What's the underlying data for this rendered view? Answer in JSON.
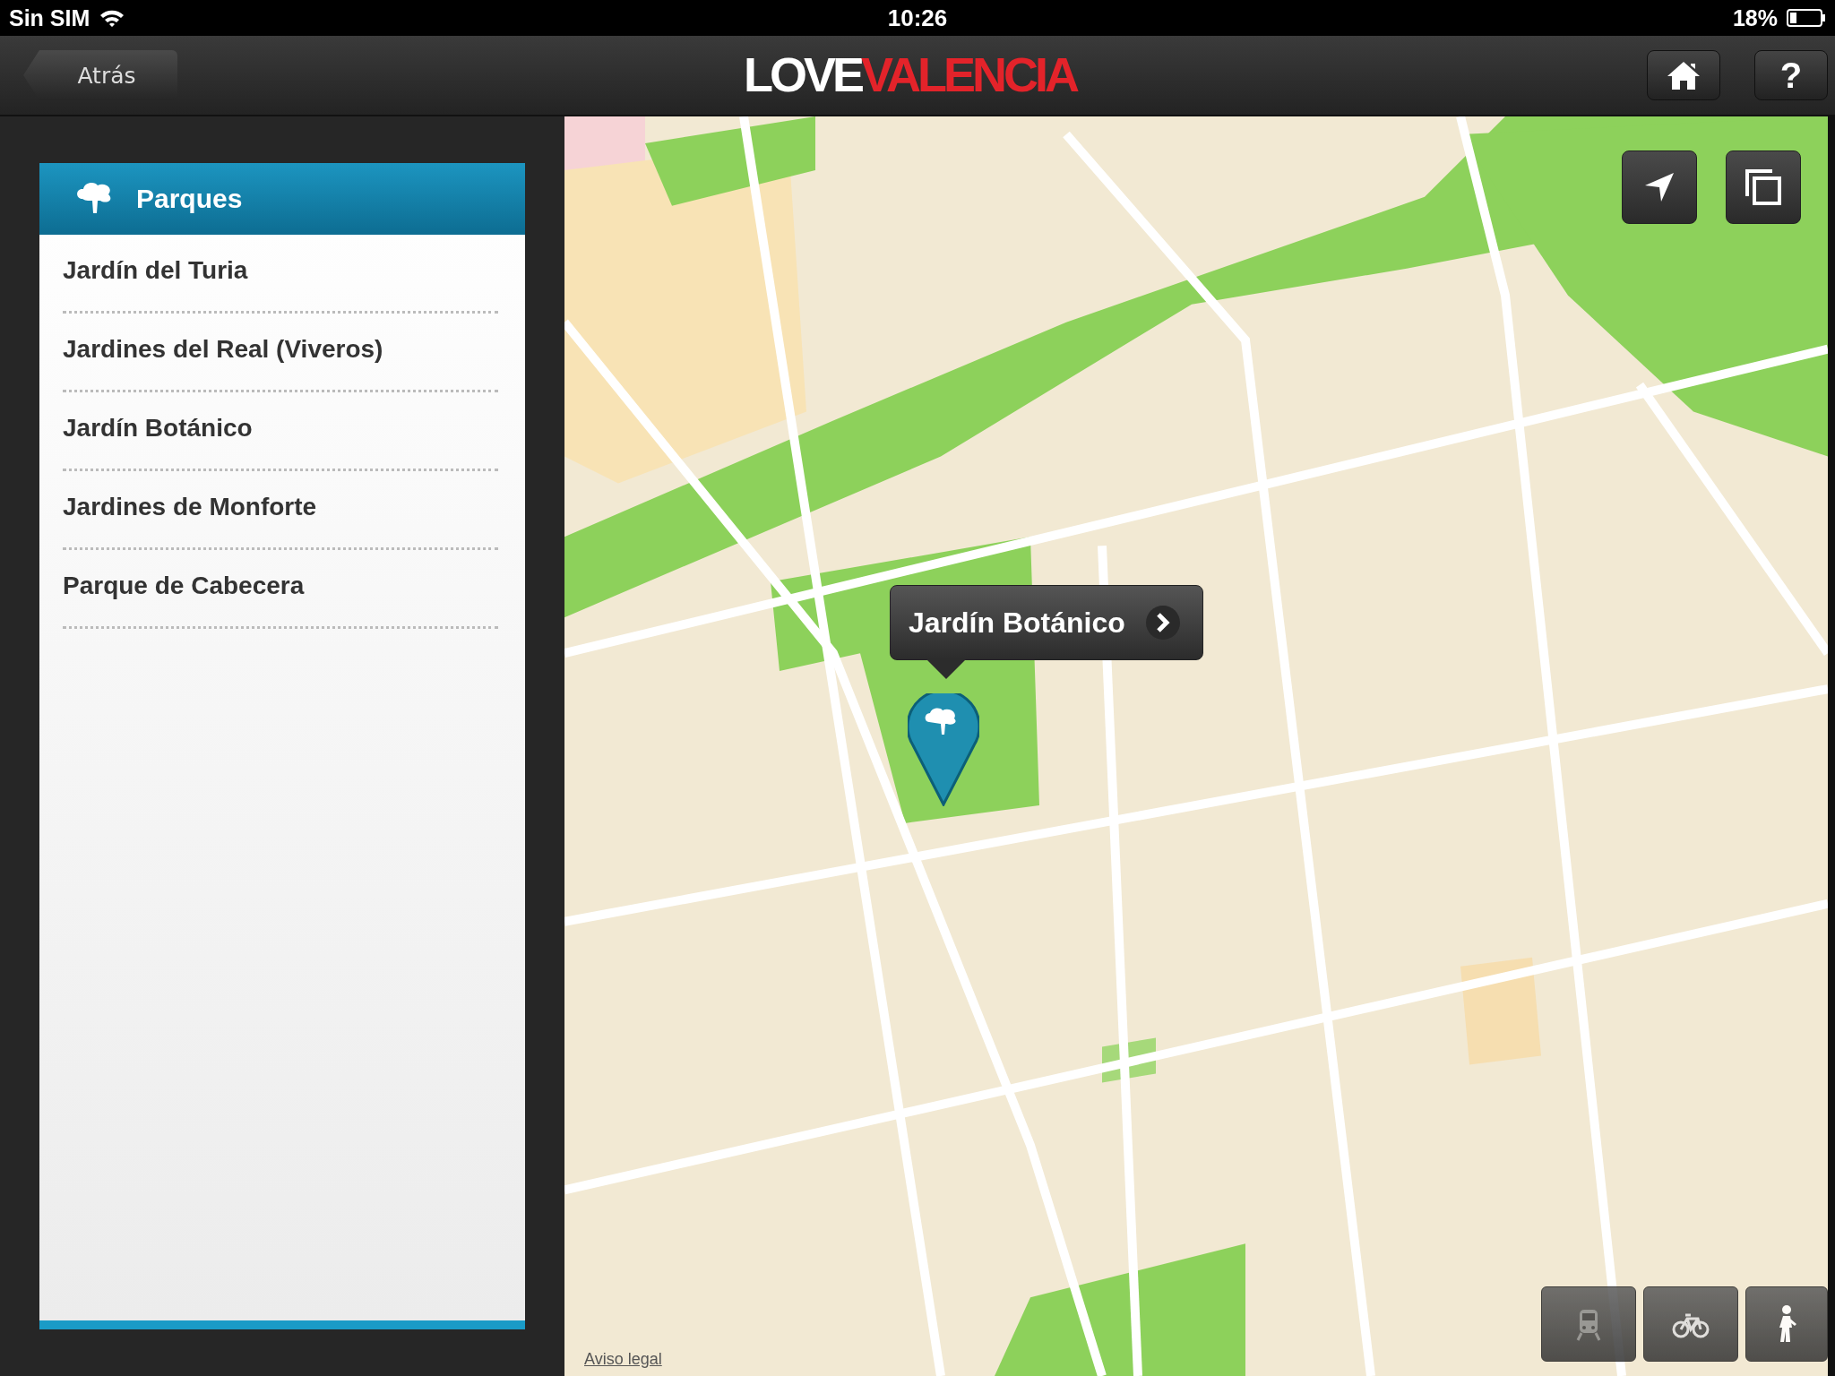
{
  "status_bar": {
    "carrier": "Sin SIM",
    "time": "10:26",
    "battery": "18%"
  },
  "nav_bar": {
    "back": "Atrás",
    "logo_first": "LOVE",
    "logo_second": "VALENCIA",
    "help": "?"
  },
  "sidebar": {
    "title": "Parques",
    "items": [
      {
        "label": "Jardín del Turia",
        "selected": false
      },
      {
        "label": "Jardines del Real (Viveros)",
        "selected": false
      },
      {
        "label": "Jardín Botánico",
        "selected": false
      },
      {
        "label": "Jardines de Monforte",
        "selected": false
      },
      {
        "label": "Parque de Cabecera",
        "selected": false
      }
    ]
  },
  "map": {
    "callout": "Jardín Botánico",
    "legal_link": "Aviso legal",
    "transport_modes": [
      {
        "kind": "train"
      },
      {
        "kind": "bike"
      },
      {
        "kind": "walk"
      }
    ]
  }
}
